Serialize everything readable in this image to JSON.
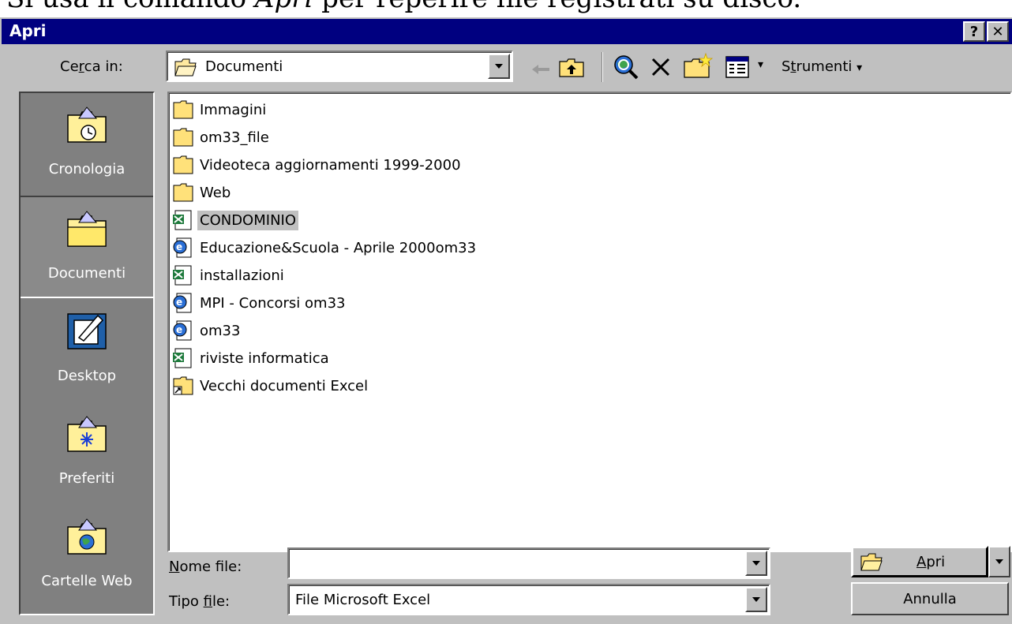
{
  "caption": {
    "pre": "Si usa il comando ",
    "italic": "Apri",
    "post": " per reperire file registrati su disco."
  },
  "dialog": {
    "title": "Apri",
    "help": "?",
    "close": "✕"
  },
  "look_in": {
    "label_pre": "Ce",
    "label_u": "r",
    "label_post": "ca in:",
    "value": "Documenti"
  },
  "toolbar": {
    "tools_pre": "S",
    "tools_u": "t",
    "tools_post": "rumenti",
    "tools_arrow": "▾",
    "views_arrow": "▾"
  },
  "places": [
    {
      "label": "Cronologia"
    },
    {
      "label": "Documenti"
    },
    {
      "label": "Desktop"
    },
    {
      "label": "Preferiti"
    },
    {
      "label": "Cartelle Web"
    }
  ],
  "files": [
    {
      "name": "Immagini",
      "icon": "folder-icon"
    },
    {
      "name": "om33_file",
      "icon": "folder-icon"
    },
    {
      "name": "Videoteca aggiornamenti 1999-2000",
      "icon": "folder-icon"
    },
    {
      "name": "Web",
      "icon": "folder-icon"
    },
    {
      "name": "CONDOMINIO",
      "icon": "excel-file-icon"
    },
    {
      "name": "Educazione&Scuola - Aprile 2000om33",
      "icon": "web-page-icon"
    },
    {
      "name": "installazioni",
      "icon": "excel-file-icon"
    },
    {
      "name": "MPI - Concorsi om33",
      "icon": "web-page-icon"
    },
    {
      "name": "om33",
      "icon": "web-page-icon"
    },
    {
      "name": "riviste informatica",
      "icon": "excel-file-icon"
    },
    {
      "name": "Vecchi documenti Excel",
      "icon": "shortcut-folder-icon"
    }
  ],
  "filename": {
    "label_u": "N",
    "label_post": "ome file:",
    "value": ""
  },
  "filetype": {
    "label_pre": "Tipo ",
    "label_u": "f",
    "label_post": "ile:",
    "value": "File Microsoft Excel"
  },
  "buttons": {
    "open_u": "A",
    "open_post": "pri",
    "cancel": "Annulla"
  },
  "colors": {
    "titlebar": "#000080",
    "face": "#c0c0c0",
    "places_bg": "#808080"
  }
}
